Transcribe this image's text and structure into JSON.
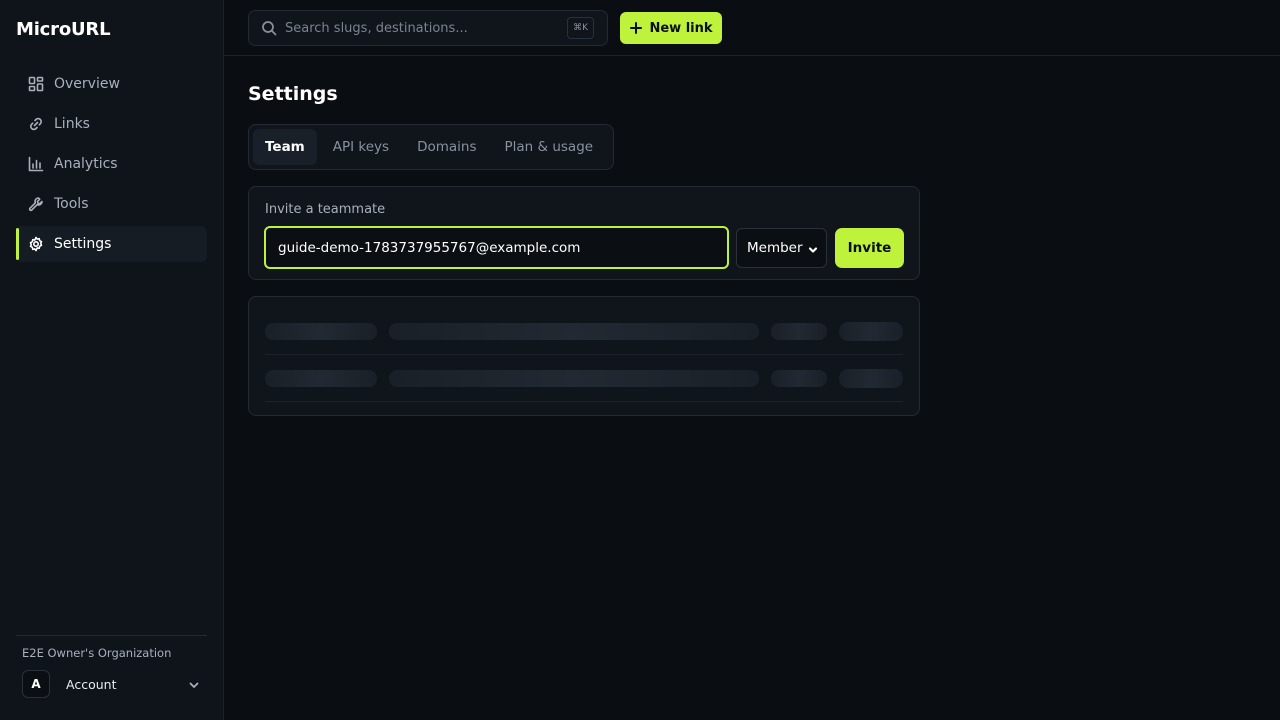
{
  "brand": {
    "name": "MicroURL"
  },
  "sidebar": {
    "items": [
      {
        "label": "Overview",
        "icon": "grid-icon",
        "active": false
      },
      {
        "label": "Links",
        "icon": "link-icon",
        "active": false
      },
      {
        "label": "Analytics",
        "icon": "bar-chart-icon",
        "active": false
      },
      {
        "label": "Tools",
        "icon": "wrench-icon",
        "active": false
      },
      {
        "label": "Settings",
        "icon": "gear-icon",
        "active": true
      }
    ],
    "org_name": "E2E Owner's Organization",
    "account": {
      "avatar_initial": "A",
      "label": "Account"
    }
  },
  "topbar": {
    "search": {
      "placeholder": "Search slugs, destinations...",
      "shortcut": "⌘K"
    },
    "new_link_label": "New link"
  },
  "page": {
    "title": "Settings",
    "tabs": [
      {
        "label": "Team",
        "active": true
      },
      {
        "label": "API keys",
        "active": false
      },
      {
        "label": "Domains",
        "active": false
      },
      {
        "label": "Plan & usage",
        "active": false
      }
    ]
  },
  "invite": {
    "label": "Invite a teammate",
    "email_value": "guide-demo-1783737955767@example.com",
    "role_selected": "Member",
    "button_label": "Invite"
  },
  "colors": {
    "accent": "#bff23a",
    "background": "#0a0d12",
    "sidebar": "#0f141b",
    "card": "#10151c"
  }
}
